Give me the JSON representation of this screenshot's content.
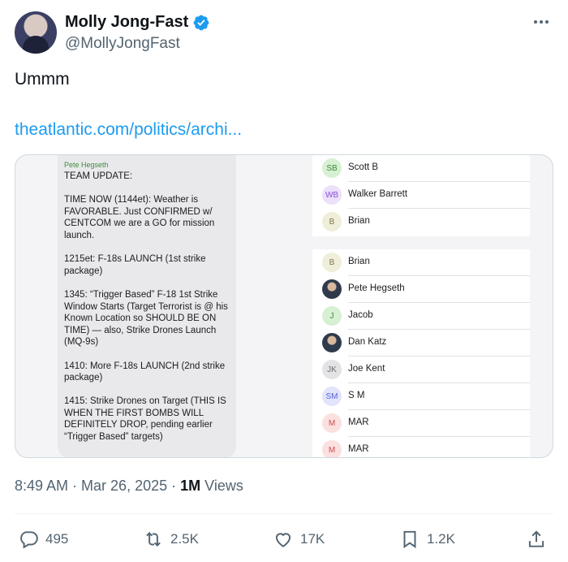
{
  "author": {
    "display_name": "Molly Jong-Fast",
    "handle": "@MollyJongFast",
    "verified_color": "#1d9bf0"
  },
  "tweet": {
    "text": "Ummm",
    "link": "theatlantic.com/politics/archi..."
  },
  "media": {
    "message": {
      "sender": "Pete Hegseth",
      "lines": [
        "TEAM UPDATE:",
        "",
        "TIME NOW (1144et): Weather is FAVORABLE. Just CONFIRMED w/ CENTCOM we are a GO for mission launch.",
        "",
        "1215et: F-18s LAUNCH (1st strike package)",
        "",
        "1345: “Trigger Based” F-18 1st Strike Window Starts (Target Terrorist is @ his Known Location so SHOULD BE ON TIME) — also, Strike Drones Launch (MQ-9s)",
        "",
        "1410: More F-18s LAUNCH (2nd strike package)",
        "",
        "1415: Strike Drones on Target (THIS IS WHEN THE FIRST BOMBS WILL DEFINITELY DROP, pending earlier “Trigger Based” targets)"
      ]
    },
    "members": [
      {
        "initials": "SB",
        "name": "Scott B",
        "bg": "#d7f0d3",
        "fg": "#3b8a3b"
      },
      {
        "initials": "WB",
        "name": "Walker Barrett",
        "bg": "#ece0fb",
        "fg": "#8a4fd8"
      },
      {
        "initials": "B",
        "name": "Brian",
        "bg": "#efeed8",
        "fg": "#7a7a55"
      },
      {
        "initials": "B",
        "name": "Brian",
        "bg": "#efeed8",
        "fg": "#7a7a55"
      },
      {
        "initials": "",
        "name": "Pete Hegseth",
        "photo": true
      },
      {
        "initials": "J",
        "name": "Jacob",
        "bg": "#d7f0d3",
        "fg": "#3b8a3b"
      },
      {
        "initials": "",
        "name": "Dan Katz",
        "photo": true
      },
      {
        "initials": "JK",
        "name": "Joe Kent",
        "bg": "#e3e3e6",
        "fg": "#6b6b70"
      },
      {
        "initials": "SM",
        "name": "S M",
        "bg": "#e2e4fb",
        "fg": "#5860d8"
      },
      {
        "initials": "M",
        "name": "MAR",
        "bg": "#fbe0e0",
        "fg": "#d04c4c"
      },
      {
        "initials": "M",
        "name": "MAR",
        "bg": "#fbe0e0",
        "fg": "#d04c4c"
      }
    ]
  },
  "meta": {
    "time": "8:49 AM",
    "date": "Mar 26, 2025",
    "views_count": "1M",
    "views_label": "Views"
  },
  "actions": {
    "replies": "495",
    "reposts": "2.5K",
    "likes": "17K",
    "bookmarks": "1.2K"
  }
}
